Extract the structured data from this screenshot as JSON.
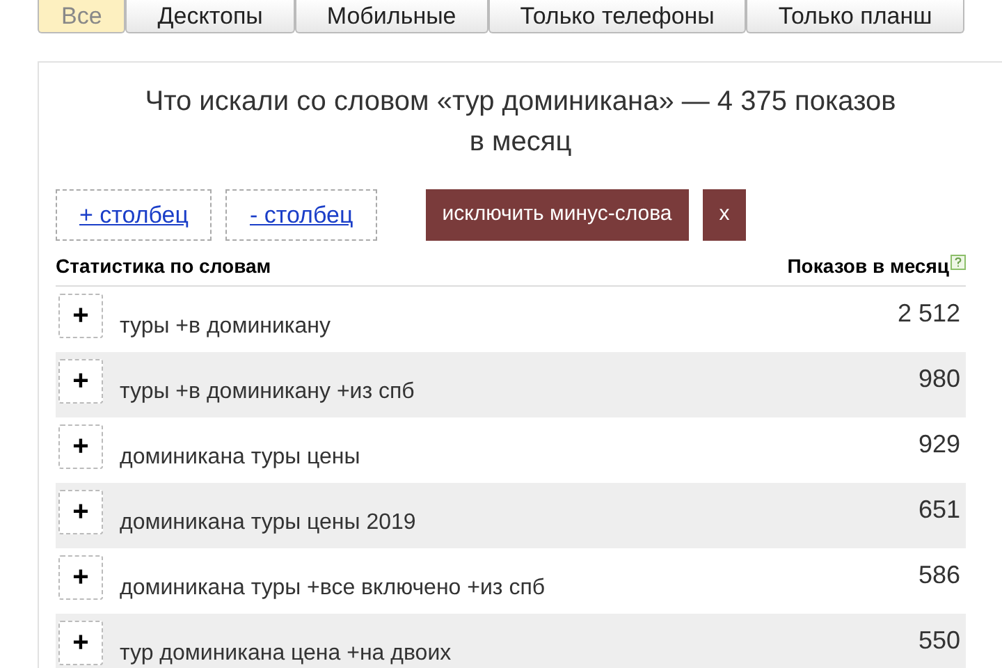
{
  "tabs": [
    {
      "label": "Все",
      "selected": true
    },
    {
      "label": "Десктопы",
      "selected": false
    },
    {
      "label": "Мобильные",
      "selected": false
    },
    {
      "label": "Только телефоны",
      "selected": false
    },
    {
      "label": "Только планш",
      "selected": false
    }
  ],
  "title": "Что искали со словом «тур доминикана» — 4 375 показов в месяц",
  "buttons": [
    {
      "kind": "link",
      "label": "+ столбец"
    },
    {
      "kind": "link",
      "label": "- столбец"
    },
    {
      "kind": "solid",
      "label": "исключить минус-слова"
    },
    {
      "kind": "solid",
      "label": "x"
    }
  ],
  "table": {
    "columns": [
      "Статистика по словам",
      "Показов в месяц"
    ],
    "rows": [
      {
        "add": "+",
        "phrase": "туры +в доминикану",
        "count": "2 512"
      },
      {
        "add": "+",
        "phrase": "туры +в доминикану +из спб",
        "count": "980"
      },
      {
        "add": "+",
        "phrase": "доминикана туры цены",
        "count": "929"
      },
      {
        "add": "+",
        "phrase": "доминикана туры цены 2019",
        "count": "651"
      },
      {
        "add": "+",
        "phrase": "доминикана туры +все включено +из спб",
        "count": "586"
      },
      {
        "add": "+",
        "phrase": "тур доминикана цена +на двоих",
        "count": "550"
      }
    ]
  }
}
